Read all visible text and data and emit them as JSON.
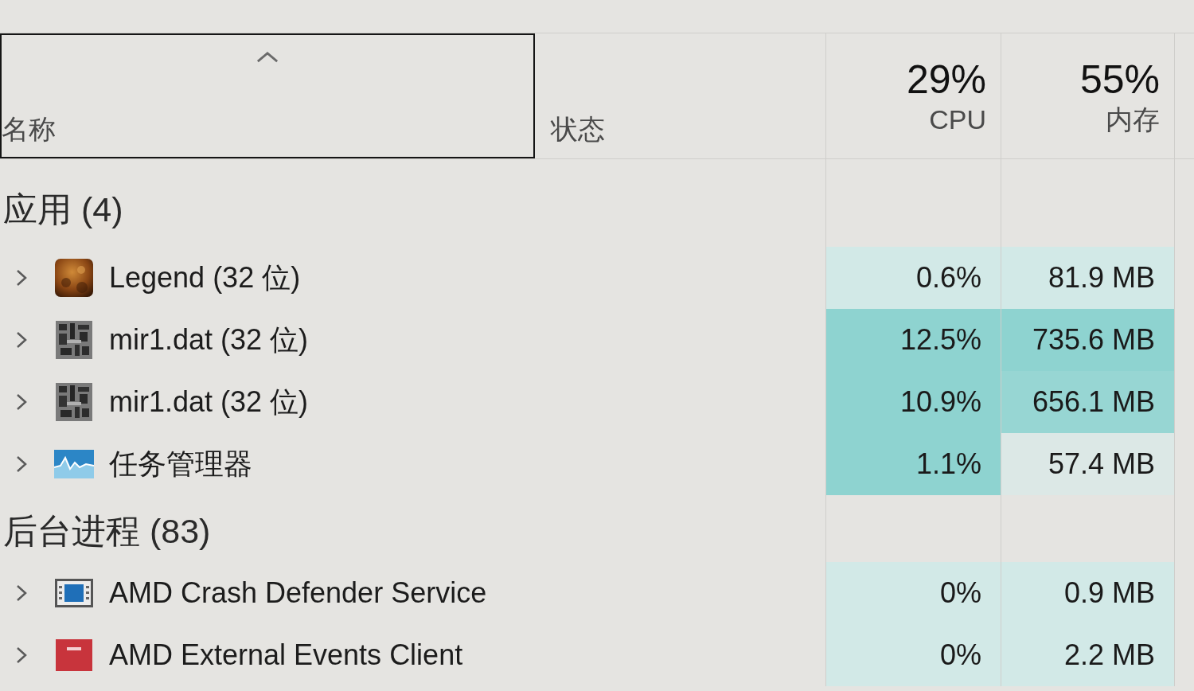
{
  "columns": [
    {
      "label": "名称",
      "selected": true,
      "sorted": true
    },
    {
      "label": "状态",
      "selected": false,
      "sorted": false
    },
    {
      "label": "CPU",
      "total": "29%",
      "selected": false,
      "sorted": false
    },
    {
      "label": "内存",
      "total": "55%",
      "selected": false,
      "sorted": false
    }
  ],
  "groups": [
    {
      "label": "应用 (4)",
      "rows": [
        {
          "name": "Legend (32 位)",
          "expanded": false,
          "cpu": {
            "value": "0.6%",
            "color": "#d2e9e7"
          },
          "memory": {
            "value": "81.9 MB",
            "color": "#d2e9e7"
          }
        },
        {
          "name": "mir1.dat (32 位)",
          "expanded": false,
          "cpu": {
            "value": "12.5%",
            "color": "#8ed3d0"
          },
          "memory": {
            "value": "735.6 MB",
            "color": "#8ed3d0"
          }
        },
        {
          "name": "mir1.dat (32 位)",
          "expanded": false,
          "cpu": {
            "value": "10.9%",
            "color": "#8ed3d0"
          },
          "memory": {
            "value": "656.1 MB",
            "color": "#97d6d3"
          }
        },
        {
          "name": "任务管理器",
          "expanded": false,
          "cpu": {
            "value": "1.1%",
            "color": "#8ed3d0"
          },
          "memory": {
            "value": "57.4 MB",
            "color": "#dce8e6"
          }
        }
      ]
    },
    {
      "label": "后台进程 (83)",
      "rows": [
        {
          "name": "AMD Crash Defender Service",
          "expanded": false,
          "cpu": {
            "value": "0%",
            "color": "#d2e9e7"
          },
          "memory": {
            "value": "0.9 MB",
            "color": "#d2e9e7"
          }
        },
        {
          "name": "AMD External Events Client",
          "expanded": false,
          "cpu": {
            "value": "0%",
            "color": "#d2e9e7"
          },
          "memory": {
            "value": "2.2 MB",
            "color": "#d2e9e7"
          }
        }
      ]
    }
  ]
}
